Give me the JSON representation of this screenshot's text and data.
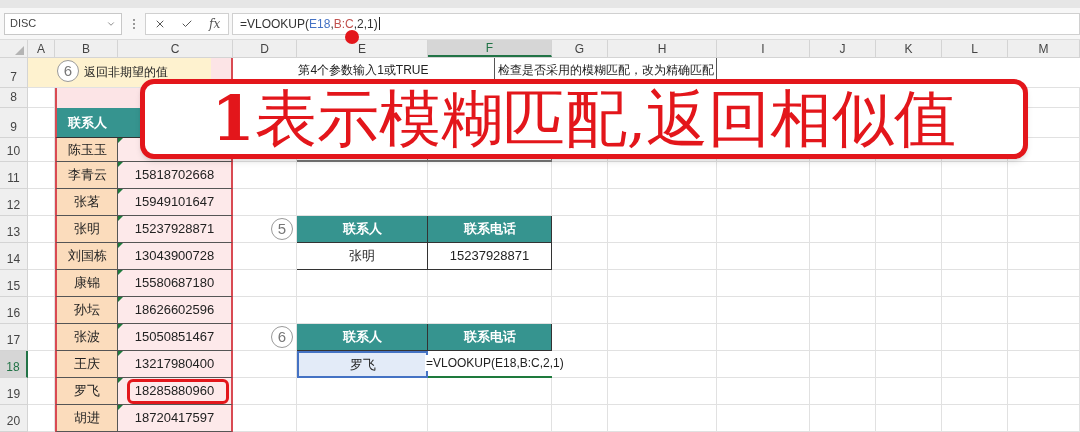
{
  "name_box": {
    "value": "DISC"
  },
  "formula_bar": {
    "fx_label": "fx",
    "parts": [
      {
        "text": "=VLOOKUP("
      },
      {
        "text": "E18",
        "color": "#4472c4"
      },
      {
        "text": ","
      },
      {
        "text": "B:C",
        "color": "#c0504d"
      },
      {
        "text": ",2,1)"
      }
    ]
  },
  "columns": [
    {
      "label": "A",
      "selected": false
    },
    {
      "label": "B",
      "selected": false
    },
    {
      "label": "C",
      "selected": false
    },
    {
      "label": "D",
      "selected": false
    },
    {
      "label": "E",
      "selected": false
    },
    {
      "label": "F",
      "selected": true
    },
    {
      "label": "G",
      "selected": false
    },
    {
      "label": "H",
      "selected": false
    },
    {
      "label": "I",
      "selected": false
    },
    {
      "label": "J",
      "selected": false
    },
    {
      "label": "K",
      "selected": false
    },
    {
      "label": "L",
      "selected": false
    },
    {
      "label": "M",
      "selected": false
    }
  ],
  "rows": [
    {
      "label": "7",
      "selected": false
    },
    {
      "label": "8",
      "selected": false
    },
    {
      "label": "9",
      "selected": false
    },
    {
      "label": "10",
      "selected": false
    },
    {
      "label": "11",
      "selected": false
    },
    {
      "label": "12",
      "selected": false
    },
    {
      "label": "13",
      "selected": false
    },
    {
      "label": "14",
      "selected": false
    },
    {
      "label": "15",
      "selected": false
    },
    {
      "label": "16",
      "selected": false
    },
    {
      "label": "17",
      "selected": false
    },
    {
      "label": "18",
      "selected": true
    },
    {
      "label": "19",
      "selected": false
    },
    {
      "label": "20",
      "selected": false
    }
  ],
  "notes": {
    "tip_number": "6",
    "tip_text": "返回非期望的值",
    "hint_1": "第4个参数输入1或TRUE",
    "hint_2": "检查是否采用的模糊匹配，改为精确匹配"
  },
  "contacts": {
    "header": "联系人",
    "rows": [
      {
        "name": "陈玉玉",
        "highlighted": false
      },
      {
        "name": "李青云",
        "phone": "15818702668",
        "highlighted": false
      },
      {
        "name": "张茗",
        "phone": "15949101647",
        "highlighted": false
      },
      {
        "name": "张明",
        "phone": "15237928871",
        "highlighted": false
      },
      {
        "name": "刘国栋",
        "phone": "13043900728",
        "highlighted": false
      },
      {
        "name": "康锦",
        "phone": "15580687180",
        "highlighted": false
      },
      {
        "name": "孙坛",
        "phone": "18626602596",
        "highlighted": false
      },
      {
        "name": "张波",
        "phone": "15050851467",
        "highlighted": false
      },
      {
        "name": "王庆",
        "phone": "13217980400",
        "highlighted": false
      },
      {
        "name": "罗飞",
        "phone": "18285880960",
        "highlighted": true
      },
      {
        "name": "胡进",
        "phone": "18720417597",
        "highlighted": false
      }
    ]
  },
  "table_5": {
    "number": "5",
    "headers": [
      "联系人",
      "联系电话"
    ],
    "row": [
      {
        "text": "张明",
        "selected": false
      },
      {
        "text": "15237928871",
        "selected": false
      }
    ]
  },
  "table_6": {
    "number": "6",
    "headers": [
      "联系人",
      "联系电话"
    ],
    "row": [
      {
        "text": "罗飞",
        "selected": true
      },
      {
        "text": "=VLOOKUP(E18,B:C,2,1)",
        "selected": false
      }
    ]
  },
  "callout": {
    "text": "**1**表示模糊匹配,返回相似值"
  }
}
